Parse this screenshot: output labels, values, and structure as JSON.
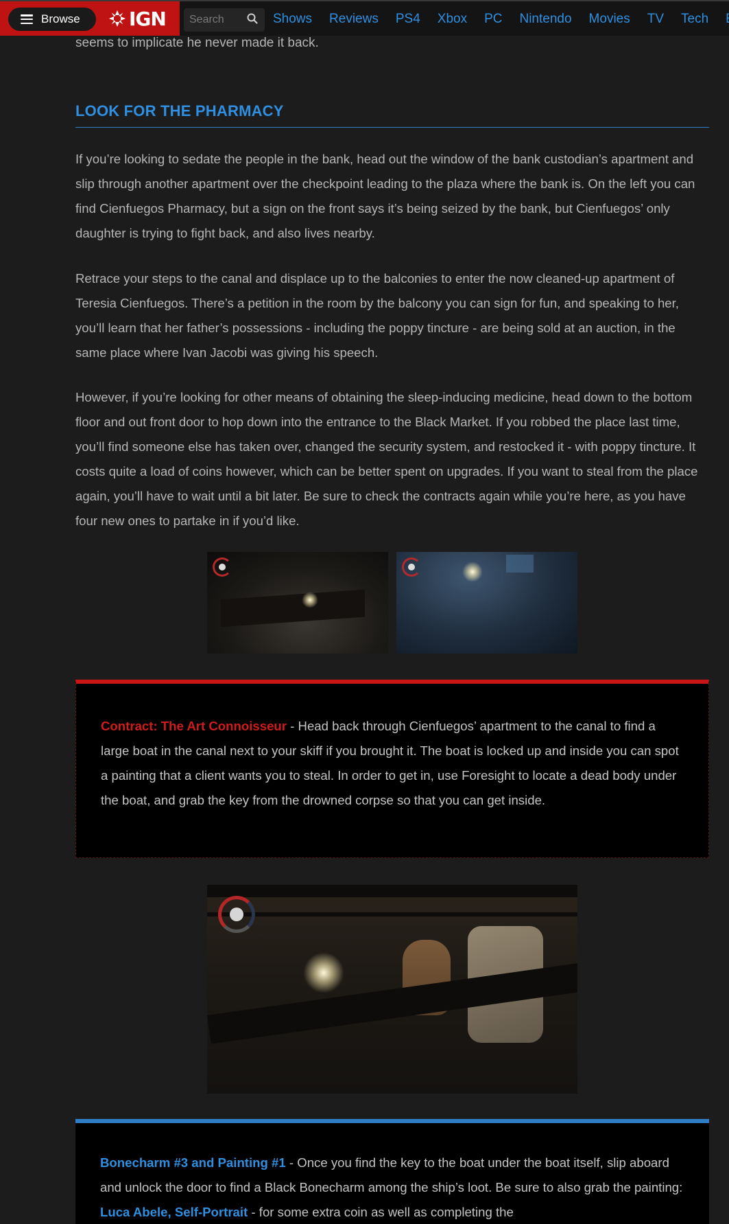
{
  "nav": {
    "browse_label": "Browse",
    "logo_text": "IGN",
    "search_placeholder": "Search",
    "links": [
      "Shows",
      "Reviews",
      "PS4",
      "Xbox",
      "PC",
      "Nintendo",
      "Movies",
      "TV",
      "Tech",
      "E"
    ]
  },
  "article": {
    "top_fragment": "seems to implicate he never made it back.",
    "section_title": "LOOK FOR THE PHARMACY",
    "paragraphs": [
      "If you’re looking to sedate the people in the bank, head out the window of the bank custodian’s apartment and slip through another apartment over the checkpoint leading to the plaza where the bank is. On the left you can find Cienfuegos Pharmacy, but a sign on the front says it’s being seized by the bank, but Cienfuegos’ only daughter is trying to fight back, and also lives nearby.",
      "Retrace your steps to the canal and displace up to the balconies to enter the now cleaned-up apartment of Teresia Cienfuegos. There’s a petition in the room by the balcony you can sign for fun, and speaking to her, you’ll learn that her father’s possessions - including the poppy tincture - are being sold at an auction, in the same place where Ivan Jacobi was giving his speech.",
      "However, if you’re looking for other means of obtaining the sleep-inducing medicine, head down to the bottom floor and out front door to hop down into the entrance to the Black Market. If you robbed the place last time, you’ll find someone else has taken over, changed the security system, and restocked it - with poppy tincture. It costs quite a load of coins however, which can be better spent on upgrades. If you want to steal from the place again, you’ll have to wait until a bit later. Be sure to check the contracts again while you’re here, as you have four new ones to partake in if you’d like."
    ],
    "contract": {
      "tag": "Contract: The Art Connoisseur",
      "text": " - Head back through Cienfuegos’ apartment to the canal to find a large boat in the canal next to your skiff if you brought it. The boat is locked up and inside you can spot a painting that a client wants you to steal. In order to get in, use Foresight to locate a dead body under the boat, and grab the key from the drowned corpse so that you can get inside."
    },
    "bonecharm": {
      "tag": "Bonecharm #3 and Painting #1",
      "text_before": " - Once you find the key to the boat under the boat itself, slip aboard and unlock the door to find a Black Bonecharm among the ship’s loot. Be sure to also grab the painting: ",
      "link": "Luca Abele, Self-Portrait",
      "text_after": " - for some extra coin as well as completing the"
    }
  },
  "colors": {
    "brand_red": "#bf1313",
    "link_blue": "#2f8fe0",
    "contract_red": "#d21b1b",
    "background": "#1c1c1c"
  },
  "icons": {
    "menu": "hamburger-icon",
    "search": "search-icon",
    "logo": "ign-logo-mark"
  }
}
